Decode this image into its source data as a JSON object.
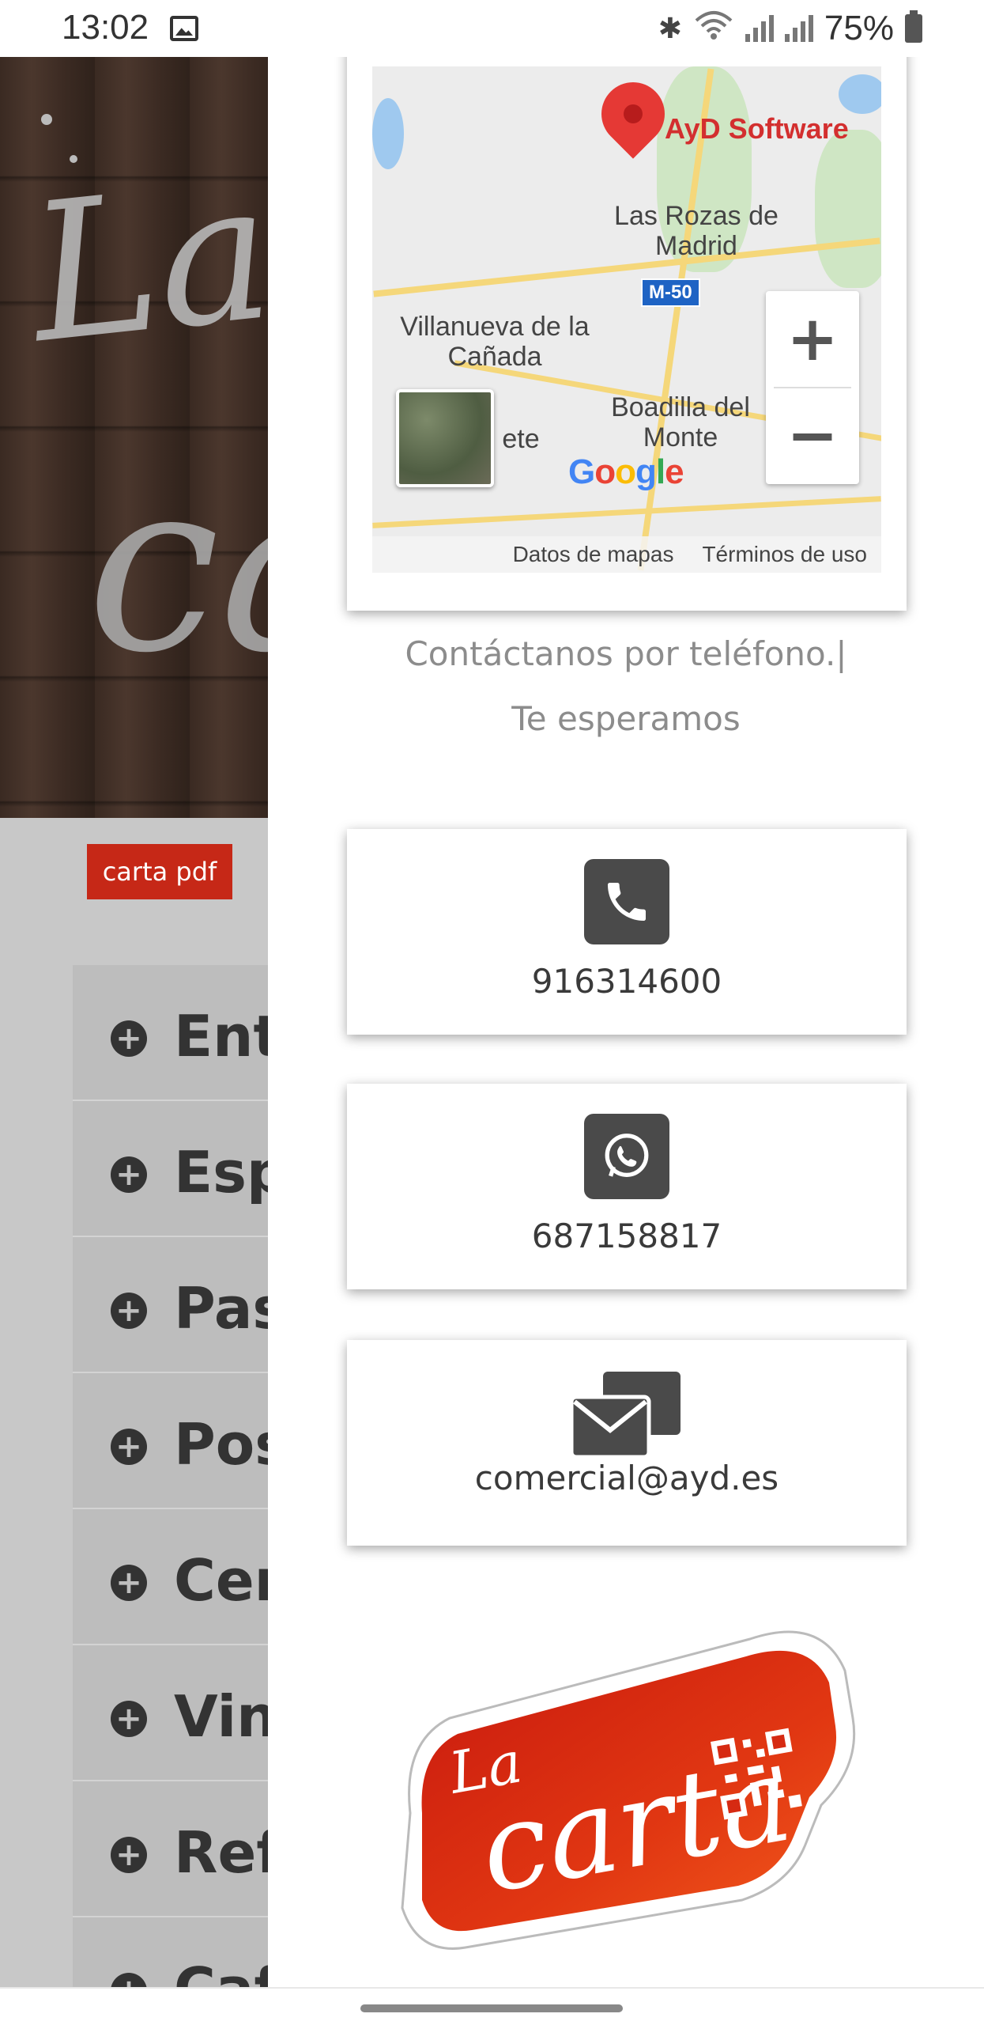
{
  "status_bar": {
    "time": "13:02",
    "battery": "75%",
    "icons": [
      "image-icon",
      "bluetooth-icon",
      "wifi-icon",
      "signal-icon",
      "signal-icon",
      "battery-icon"
    ]
  },
  "background_page": {
    "wood_text_line1": "La",
    "wood_text_line2": "ca",
    "pdf_button": "carta pdf",
    "menu_items": [
      "Ent",
      "Esp",
      "Pas",
      "Pos",
      "Cer",
      "Vin",
      "Ref",
      "Caf"
    ]
  },
  "map": {
    "pin_label": "AyD Software",
    "places": [
      "Las Rozas de Madrid",
      "Villanueva de la Cañada",
      "Boadilla del Monte",
      "ete"
    ],
    "road_badge": "M-50",
    "zoom_in": "+",
    "zoom_out": "−",
    "google": "Google",
    "footer_left": "Datos de mapas",
    "footer_right": "Términos de uso"
  },
  "contact": {
    "line1": "Contáctanos por teléfono.|",
    "line2": "Te esperamos",
    "phone": "916314600",
    "whatsapp": "687158817",
    "email": "comercial@ayd.es"
  },
  "sticker": {
    "small": "La",
    "big": "carta"
  },
  "colors": {
    "pdf_button": "#c62817",
    "sticker_red": "#d62a12",
    "icon_dark": "#4a4a4a"
  }
}
